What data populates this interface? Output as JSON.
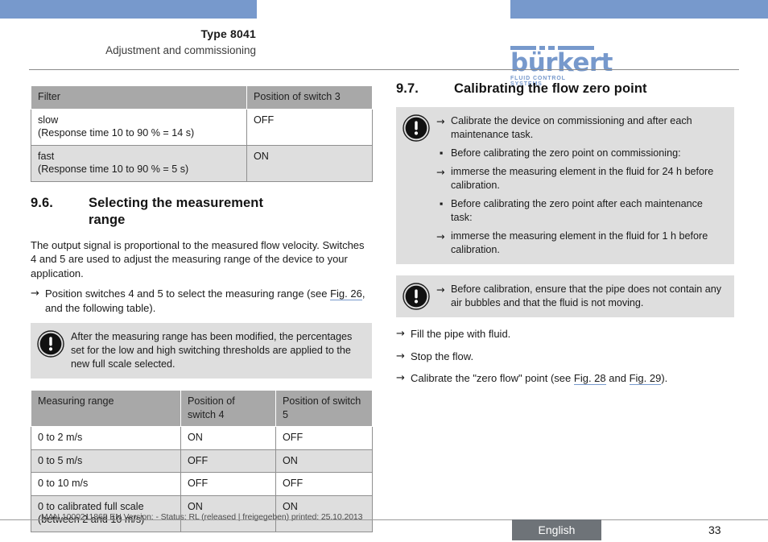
{
  "header": {
    "doc_type": "Type 8041",
    "subtitle": "Adjustment and commissioning",
    "logo_word": "bürkert",
    "logo_tagline": "FLUID CONTROL SYSTEMS",
    "accent_color": "#7799cc"
  },
  "filter_table": {
    "headers": [
      "Filter",
      "Position of switch 3"
    ],
    "rows": [
      [
        "slow\n(Response time 10 to 90 % = 14 s)",
        "OFF"
      ],
      [
        "fast\n(Response time 10 to 90 % = 5 s)",
        "ON"
      ]
    ],
    "row_cells": {
      "r0c0_line1": "slow",
      "r0c0_line2": "(Response time 10 to 90 % = 14 s)",
      "r0c1": "OFF",
      "r1c0_line1": "fast",
      "r1c0_line2": "(Response time 10 to 90 % = 5 s)",
      "r1c1": "ON"
    }
  },
  "section_96": {
    "number": "9.6.",
    "title_line1": "Selecting the measurement",
    "title_line2": "range",
    "paragraph": "The output signal is proportional to the measured flow velocity. Switches 4 and 5 are used to adjust the measuring range of the device to your application.",
    "step": {
      "marker": "→",
      "text_before": "Position switches 4 and 5 to select the measuring range (see ",
      "xref": "Fig. 26",
      "text_after": ", and the following table)."
    },
    "note": {
      "icon": "warning-exclamation-icon",
      "text": "After the measuring range has been modified, the percentages set for the low and high switching thresholds are applied to the new full scale selected."
    }
  },
  "range_table": {
    "headers": [
      "Measuring range",
      "Position of switch 4",
      "Position of switch 5"
    ],
    "header_cells": {
      "c0": "Measuring range",
      "c1_line1": "Position of",
      "c1_line2": "switch 4",
      "c2_line1": "Position of switch",
      "c2_line2": "5"
    },
    "rows": [
      {
        "range": "0 to 2 m/s",
        "range_line2": "",
        "switch4": "ON",
        "switch5": "OFF"
      },
      {
        "range": "0 to 5 m/s",
        "range_line2": "",
        "switch4": "OFF",
        "switch5": "ON"
      },
      {
        "range": "0 to 10 m/s",
        "range_line2": "",
        "switch4": "OFF",
        "switch5": "OFF"
      },
      {
        "range": "0 to calibrated full scale",
        "range_line2": "(between 2 and 10 m/s)",
        "switch4": "ON",
        "switch5": "ON"
      }
    ]
  },
  "section_97": {
    "number": "9.7.",
    "title": "Calibrating the flow zero point",
    "note1": {
      "icon": "warning-exclamation-icon",
      "items": [
        {
          "marker": "→",
          "text": "Calibrate the device on commissioning and after each maintenance task."
        },
        {
          "marker": "▪",
          "text": "Before calibrating the zero point on commissioning:"
        },
        {
          "marker": "→",
          "text": "immerse the measuring element in the fluid for 24 h before calibration."
        },
        {
          "marker": "▪",
          "text": "Before calibrating the zero point after each maintenance task:"
        },
        {
          "marker": "→",
          "text": "immerse the measuring element in the fluid for 1 h before calibration."
        }
      ]
    },
    "note2": {
      "icon": "warning-exclamation-icon",
      "marker": "→",
      "text": "Before calibration, ensure that the pipe does not contain any air bubbles and that the fluid is not moving."
    },
    "steps": [
      {
        "marker": "→",
        "text": "Fill the pipe with fluid."
      },
      {
        "marker": "→",
        "text": "Stop the flow."
      }
    ],
    "final_step": {
      "marker": "→",
      "text_before": "Calibrate the \"zero flow\" point (see ",
      "xref1": "Fig. 28",
      "text_middle": " and ",
      "xref2": "Fig. 29",
      "text_after": ")."
    }
  },
  "footer": {
    "code": "MAN 1000211865 EN Version: - Status: RL (released | freigegeben) printed: 25.10.2013",
    "language": "English",
    "page_number": "33"
  }
}
